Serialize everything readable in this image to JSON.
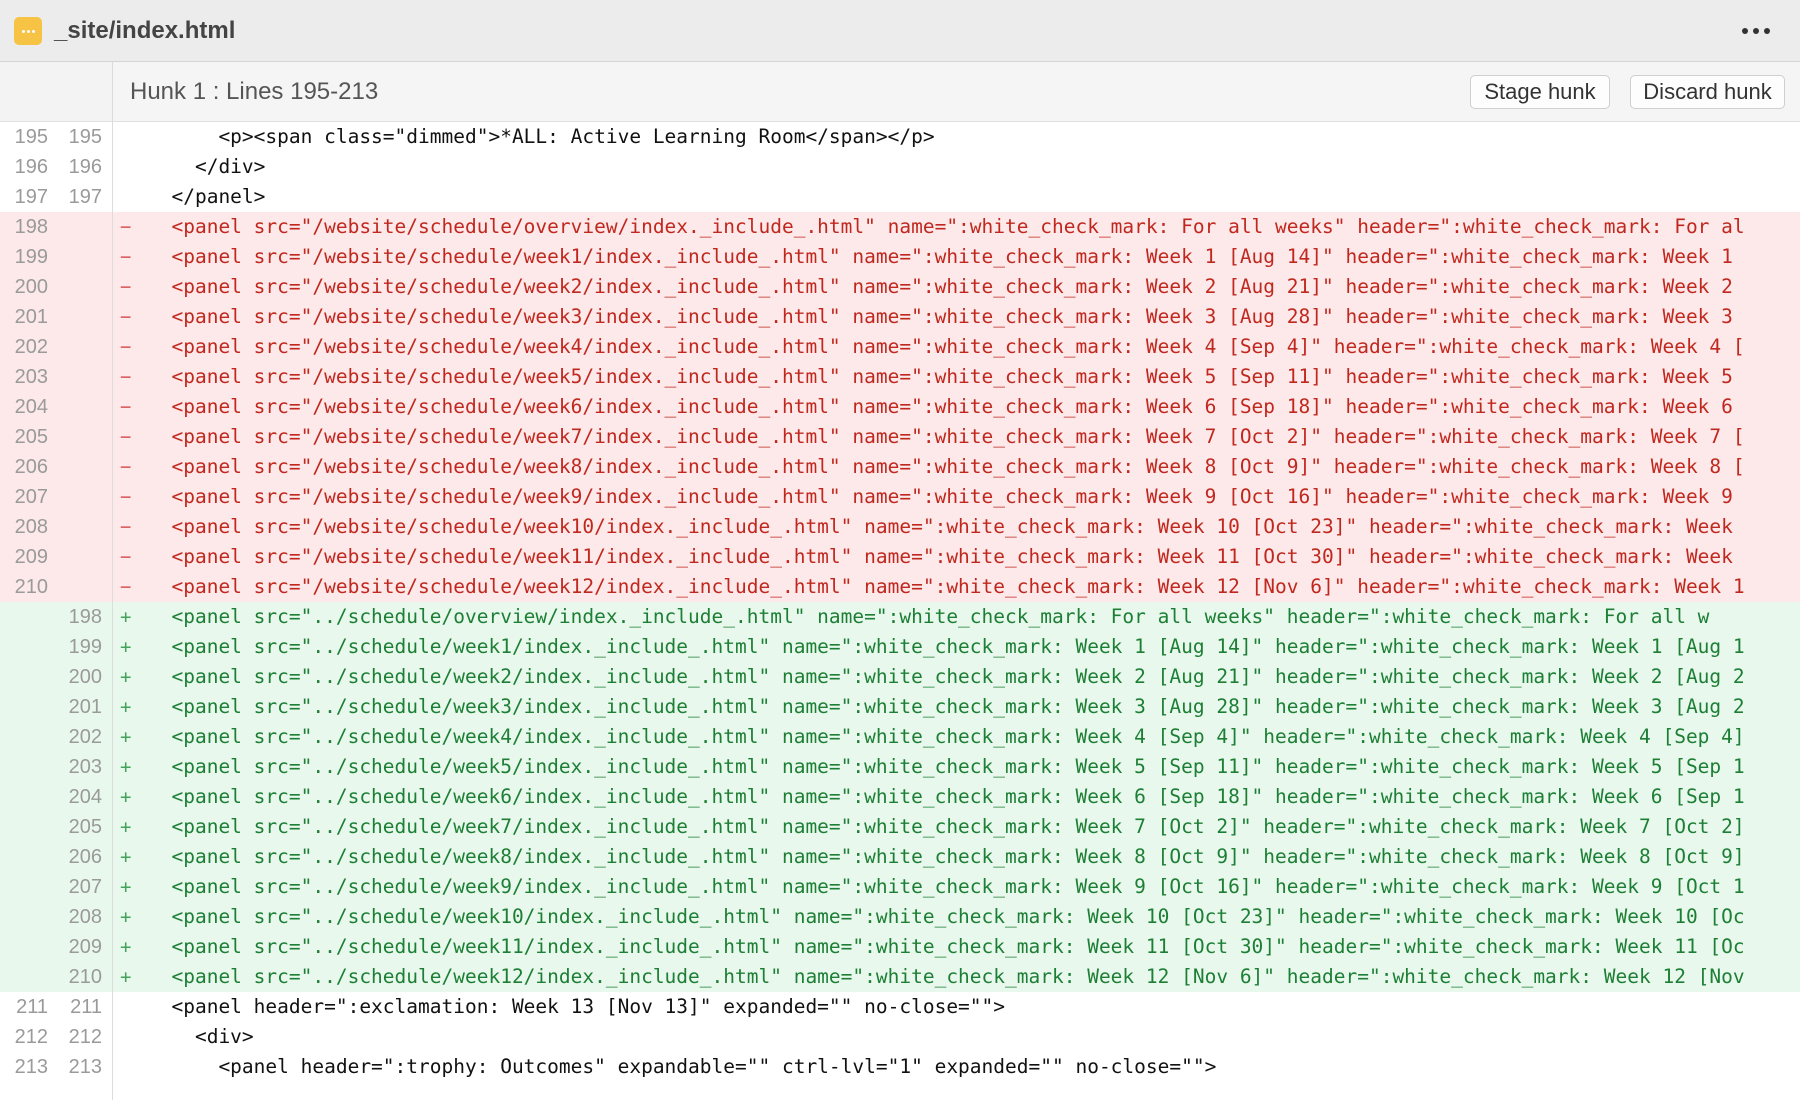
{
  "header": {
    "file_name": "_site/index.html",
    "file_icon": "file-dots-icon",
    "more_icon": "more-options-icon"
  },
  "hunk": {
    "title": "Hunk 1 : Lines 195-213",
    "stage_label": "Stage hunk",
    "discard_label": "Discard hunk"
  },
  "colors": {
    "deleted_bg": "#fde9e9",
    "deleted_text": "#c0281f",
    "added_bg": "#e8f8ec",
    "added_text": "#1d7f35",
    "file_icon": "#f6c344"
  },
  "lines": [
    {
      "type": "ctx",
      "old": "195",
      "new": "195",
      "sign": "",
      "text": "      <p><span class=\"dimmed\">*ALL: Active Learning Room</span></p>"
    },
    {
      "type": "ctx",
      "old": "196",
      "new": "196",
      "sign": "",
      "text": "    </div>"
    },
    {
      "type": "ctx",
      "old": "197",
      "new": "197",
      "sign": "",
      "text": "  </panel>"
    },
    {
      "type": "del",
      "old": "198",
      "new": "",
      "sign": "−",
      "text": "  <panel src=\"/website/schedule/overview/index._include_.html\" name=\":white_check_mark: For all weeks\" header=\":white_check_mark: For al"
    },
    {
      "type": "del",
      "old": "199",
      "new": "",
      "sign": "−",
      "text": "  <panel src=\"/website/schedule/week1/index._include_.html\" name=\":white_check_mark: Week 1 [Aug 14]\" header=\":white_check_mark: Week 1"
    },
    {
      "type": "del",
      "old": "200",
      "new": "",
      "sign": "−",
      "text": "  <panel src=\"/website/schedule/week2/index._include_.html\" name=\":white_check_mark: Week 2 [Aug 21]\" header=\":white_check_mark: Week 2"
    },
    {
      "type": "del",
      "old": "201",
      "new": "",
      "sign": "−",
      "text": "  <panel src=\"/website/schedule/week3/index._include_.html\" name=\":white_check_mark: Week 3 [Aug 28]\" header=\":white_check_mark: Week 3"
    },
    {
      "type": "del",
      "old": "202",
      "new": "",
      "sign": "−",
      "text": "  <panel src=\"/website/schedule/week4/index._include_.html\" name=\":white_check_mark: Week 4 [Sep 4]\" header=\":white_check_mark: Week 4 ["
    },
    {
      "type": "del",
      "old": "203",
      "new": "",
      "sign": "−",
      "text": "  <panel src=\"/website/schedule/week5/index._include_.html\" name=\":white_check_mark: Week 5 [Sep 11]\" header=\":white_check_mark: Week 5"
    },
    {
      "type": "del",
      "old": "204",
      "new": "",
      "sign": "−",
      "text": "  <panel src=\"/website/schedule/week6/index._include_.html\" name=\":white_check_mark: Week 6 [Sep 18]\" header=\":white_check_mark: Week 6"
    },
    {
      "type": "del",
      "old": "205",
      "new": "",
      "sign": "−",
      "text": "  <panel src=\"/website/schedule/week7/index._include_.html\" name=\":white_check_mark: Week 7 [Oct 2]\" header=\":white_check_mark: Week 7 ["
    },
    {
      "type": "del",
      "old": "206",
      "new": "",
      "sign": "−",
      "text": "  <panel src=\"/website/schedule/week8/index._include_.html\" name=\":white_check_mark: Week 8 [Oct 9]\" header=\":white_check_mark: Week 8 ["
    },
    {
      "type": "del",
      "old": "207",
      "new": "",
      "sign": "−",
      "text": "  <panel src=\"/website/schedule/week9/index._include_.html\" name=\":white_check_mark: Week 9 [Oct 16]\" header=\":white_check_mark: Week 9"
    },
    {
      "type": "del",
      "old": "208",
      "new": "",
      "sign": "−",
      "text": "  <panel src=\"/website/schedule/week10/index._include_.html\" name=\":white_check_mark: Week 10 [Oct 23]\" header=\":white_check_mark: Week"
    },
    {
      "type": "del",
      "old": "209",
      "new": "",
      "sign": "−",
      "text": "  <panel src=\"/website/schedule/week11/index._include_.html\" name=\":white_check_mark: Week 11 [Oct 30]\" header=\":white_check_mark: Week"
    },
    {
      "type": "del",
      "old": "210",
      "new": "",
      "sign": "−",
      "text": "  <panel src=\"/website/schedule/week12/index._include_.html\" name=\":white_check_mark: Week 12 [Nov 6]\" header=\":white_check_mark: Week 1"
    },
    {
      "type": "add",
      "old": "",
      "new": "198",
      "sign": "+",
      "text": "  <panel src=\"../schedule/overview/index._include_.html\" name=\":white_check_mark: For all weeks\" header=\":white_check_mark: For all w"
    },
    {
      "type": "add",
      "old": "",
      "new": "199",
      "sign": "+",
      "text": "  <panel src=\"../schedule/week1/index._include_.html\" name=\":white_check_mark: Week 1 [Aug 14]\" header=\":white_check_mark: Week 1 [Aug 1"
    },
    {
      "type": "add",
      "old": "",
      "new": "200",
      "sign": "+",
      "text": "  <panel src=\"../schedule/week2/index._include_.html\" name=\":white_check_mark: Week 2 [Aug 21]\" header=\":white_check_mark: Week 2 [Aug 2"
    },
    {
      "type": "add",
      "old": "",
      "new": "201",
      "sign": "+",
      "text": "  <panel src=\"../schedule/week3/index._include_.html\" name=\":white_check_mark: Week 3 [Aug 28]\" header=\":white_check_mark: Week 3 [Aug 2"
    },
    {
      "type": "add",
      "old": "",
      "new": "202",
      "sign": "+",
      "text": "  <panel src=\"../schedule/week4/index._include_.html\" name=\":white_check_mark: Week 4 [Sep 4]\" header=\":white_check_mark: Week 4 [Sep 4]"
    },
    {
      "type": "add",
      "old": "",
      "new": "203",
      "sign": "+",
      "text": "  <panel src=\"../schedule/week5/index._include_.html\" name=\":white_check_mark: Week 5 [Sep 11]\" header=\":white_check_mark: Week 5 [Sep 1"
    },
    {
      "type": "add",
      "old": "",
      "new": "204",
      "sign": "+",
      "text": "  <panel src=\"../schedule/week6/index._include_.html\" name=\":white_check_mark: Week 6 [Sep 18]\" header=\":white_check_mark: Week 6 [Sep 1"
    },
    {
      "type": "add",
      "old": "",
      "new": "205",
      "sign": "+",
      "text": "  <panel src=\"../schedule/week7/index._include_.html\" name=\":white_check_mark: Week 7 [Oct 2]\" header=\":white_check_mark: Week 7 [Oct 2]"
    },
    {
      "type": "add",
      "old": "",
      "new": "206",
      "sign": "+",
      "text": "  <panel src=\"../schedule/week8/index._include_.html\" name=\":white_check_mark: Week 8 [Oct 9]\" header=\":white_check_mark: Week 8 [Oct 9]"
    },
    {
      "type": "add",
      "old": "",
      "new": "207",
      "sign": "+",
      "text": "  <panel src=\"../schedule/week9/index._include_.html\" name=\":white_check_mark: Week 9 [Oct 16]\" header=\":white_check_mark: Week 9 [Oct 1"
    },
    {
      "type": "add",
      "old": "",
      "new": "208",
      "sign": "+",
      "text": "  <panel src=\"../schedule/week10/index._include_.html\" name=\":white_check_mark: Week 10 [Oct 23]\" header=\":white_check_mark: Week 10 [Oc"
    },
    {
      "type": "add",
      "old": "",
      "new": "209",
      "sign": "+",
      "text": "  <panel src=\"../schedule/week11/index._include_.html\" name=\":white_check_mark: Week 11 [Oct 30]\" header=\":white_check_mark: Week 11 [Oc"
    },
    {
      "type": "add",
      "old": "",
      "new": "210",
      "sign": "+",
      "text": "  <panel src=\"../schedule/week12/index._include_.html\" name=\":white_check_mark: Week 12 [Nov 6]\" header=\":white_check_mark: Week 12 [Nov"
    },
    {
      "type": "ctx",
      "old": "211",
      "new": "211",
      "sign": "",
      "text": "  <panel header=\":exclamation: Week 13 [Nov 13]\" expanded=\"\" no-close=\"\">"
    },
    {
      "type": "ctx",
      "old": "212",
      "new": "212",
      "sign": "",
      "text": "    <div>"
    },
    {
      "type": "ctx",
      "old": "213",
      "new": "213",
      "sign": "",
      "text": "      <panel header=\":trophy: Outcomes\" expandable=\"\" ctrl-lvl=\"1\" expanded=\"\" no-close=\"\">"
    }
  ]
}
